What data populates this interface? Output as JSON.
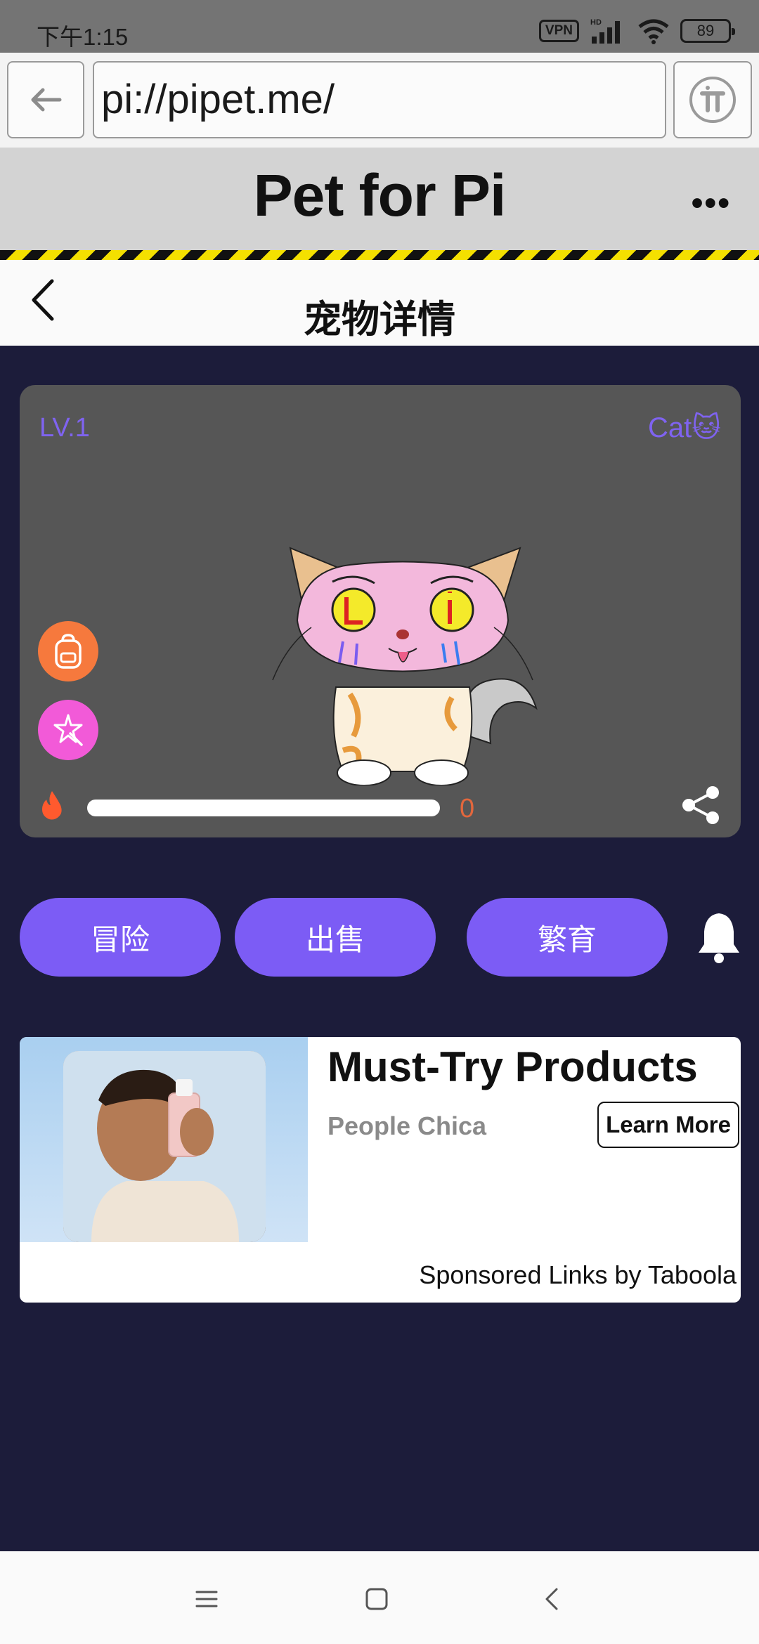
{
  "status_bar": {
    "time": "下午1:15",
    "vpn_label": "VPN",
    "signal_label": "HD",
    "battery": "89"
  },
  "browser": {
    "url": "pi://pipet.me/"
  },
  "app": {
    "title": "Pet for Pi",
    "more_label": "•••"
  },
  "page": {
    "title": "宠物详情"
  },
  "pet": {
    "level": "LV.1",
    "type": "Cat🐱",
    "progress_value": "0",
    "progress_fraction": 0
  },
  "actions": [
    {
      "label": "冒险"
    },
    {
      "label": "出售"
    },
    {
      "label": "繁育"
    }
  ],
  "ad": {
    "title": "Must-Try Products",
    "source": "People Chica",
    "cta": "Learn More",
    "footer": "Sponsored Links by Taboola"
  },
  "icons": {
    "back": "arrow-left-icon",
    "pi": "pi-logo-icon",
    "backpack": "backpack-icon",
    "magic": "magic-wand-icon",
    "fire": "fire-icon",
    "share": "share-icon",
    "bell": "bell-icon"
  },
  "colors": {
    "accent": "#7c5cf5",
    "background": "#1c1c3a",
    "card": "#565656",
    "level_text": "#7f63f0",
    "progress_value": "#e2673d"
  }
}
